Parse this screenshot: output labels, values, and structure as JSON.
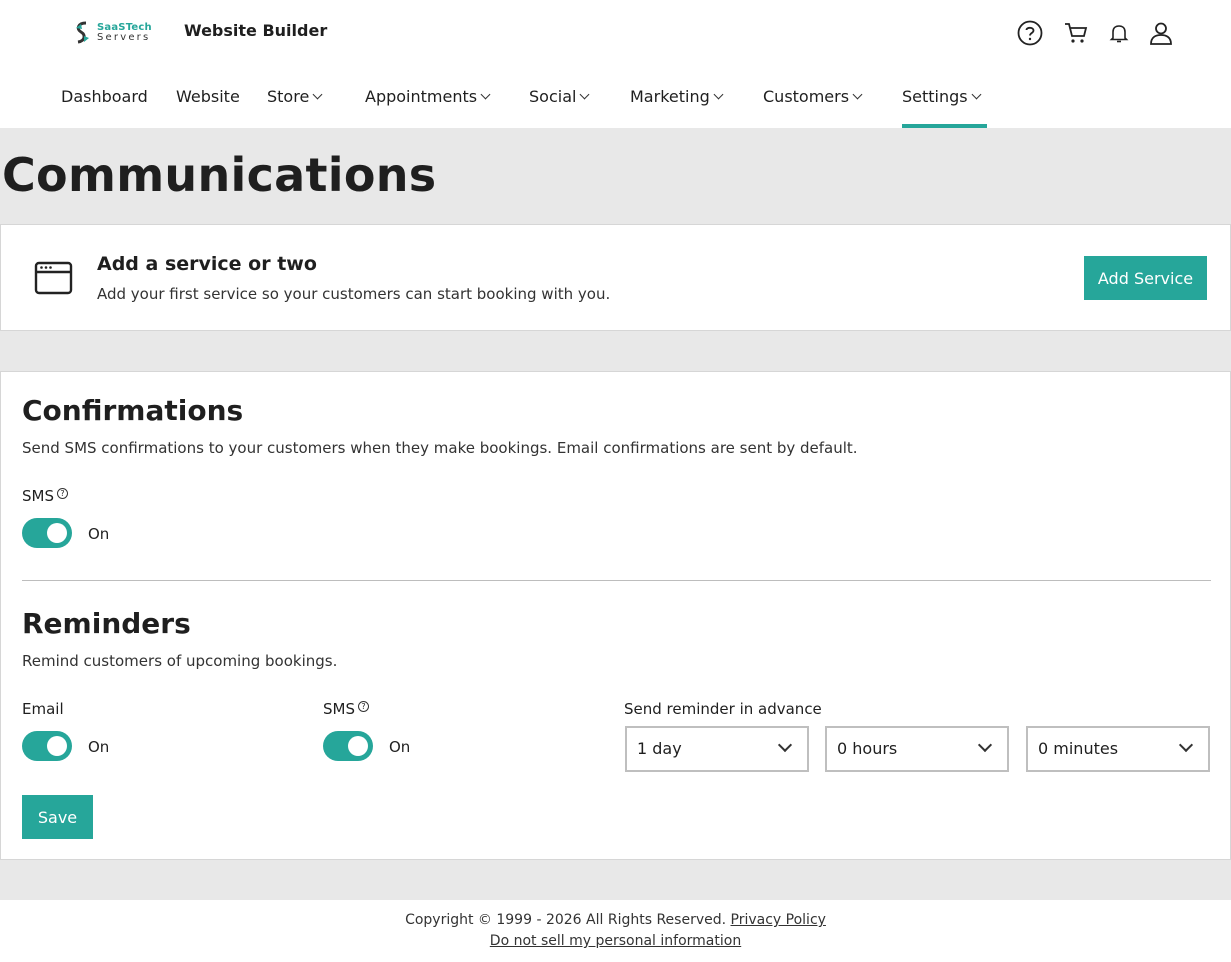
{
  "header": {
    "logo_line1": "SaaSTech",
    "logo_line2": "Servers",
    "brand": "Website Builder",
    "icons": [
      "help-icon",
      "cart-icon",
      "bell-icon",
      "user-icon"
    ]
  },
  "nav": [
    {
      "label": "Dashboard",
      "dropdown": false
    },
    {
      "label": "Website",
      "dropdown": false
    },
    {
      "label": "Store",
      "dropdown": true
    },
    {
      "label": "Appointments",
      "dropdown": true
    },
    {
      "label": "Social",
      "dropdown": true
    },
    {
      "label": "Marketing",
      "dropdown": true
    },
    {
      "label": "Customers",
      "dropdown": true
    },
    {
      "label": "Settings",
      "dropdown": true,
      "active": true
    }
  ],
  "page": {
    "title": "Communications"
  },
  "service_card": {
    "title": "Add a service or two",
    "description": "Add your first service so your customers can start booking with you.",
    "button_label": "Add Service"
  },
  "confirmations": {
    "title": "Confirmations",
    "description": "Send SMS confirmations to your customers when they make bookings. Email confirmations are sent by default.",
    "sms_label": "SMS",
    "sms_state": "On"
  },
  "reminders": {
    "title": "Reminders",
    "description": "Remind customers of upcoming bookings.",
    "email_label": "Email",
    "email_state": "On",
    "sms_label": "SMS",
    "sms_state": "On",
    "advance_label": "Send reminder in advance",
    "days_value": "1 day",
    "hours_value": "0 hours",
    "minutes_value": "0 minutes",
    "save_label": "Save"
  },
  "footer": {
    "copyright": "Copyright © 1999 - 2026 All Rights Reserved.",
    "privacy_link": "Privacy Policy",
    "do_not_sell_link": "Do not sell my personal information"
  },
  "colors": {
    "accent": "#26a69a",
    "background": "#e8e8e8"
  }
}
